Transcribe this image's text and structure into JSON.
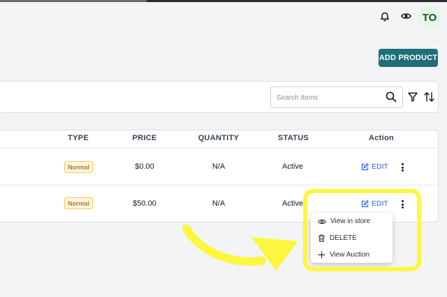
{
  "header": {
    "avatar_initials": "TO",
    "icons": [
      "bell-icon",
      "eye-icon"
    ]
  },
  "actions": {
    "add_product_label": "ADD PRODUCT"
  },
  "toolbar": {
    "search_placeholder": "Search Items",
    "icons": [
      "search-icon",
      "filter-icon",
      "sort-icon"
    ]
  },
  "table": {
    "columns": [
      "TYPE",
      "PRICE",
      "QUANTITY",
      "STATUS",
      "Action"
    ],
    "rows": [
      {
        "type": "Normal",
        "price": "$0.00",
        "quantity": "N/A",
        "status": "Active",
        "edit_label": "EDIT"
      },
      {
        "type": "Normal",
        "price": "$50.00",
        "quantity": "N/A",
        "status": "Active",
        "edit_label": "EDIT"
      }
    ]
  },
  "context_menu": {
    "items": [
      {
        "label": "View in store",
        "icon": "eye-icon"
      },
      {
        "label": "DELETE",
        "icon": "trash-icon"
      },
      {
        "label": "View Auction",
        "icon": "plus-icon"
      }
    ]
  },
  "colors": {
    "brand": "#1f6e7a",
    "link": "#2563eb",
    "badge_text": "#b7791f",
    "highlight": "#fcf73e"
  }
}
